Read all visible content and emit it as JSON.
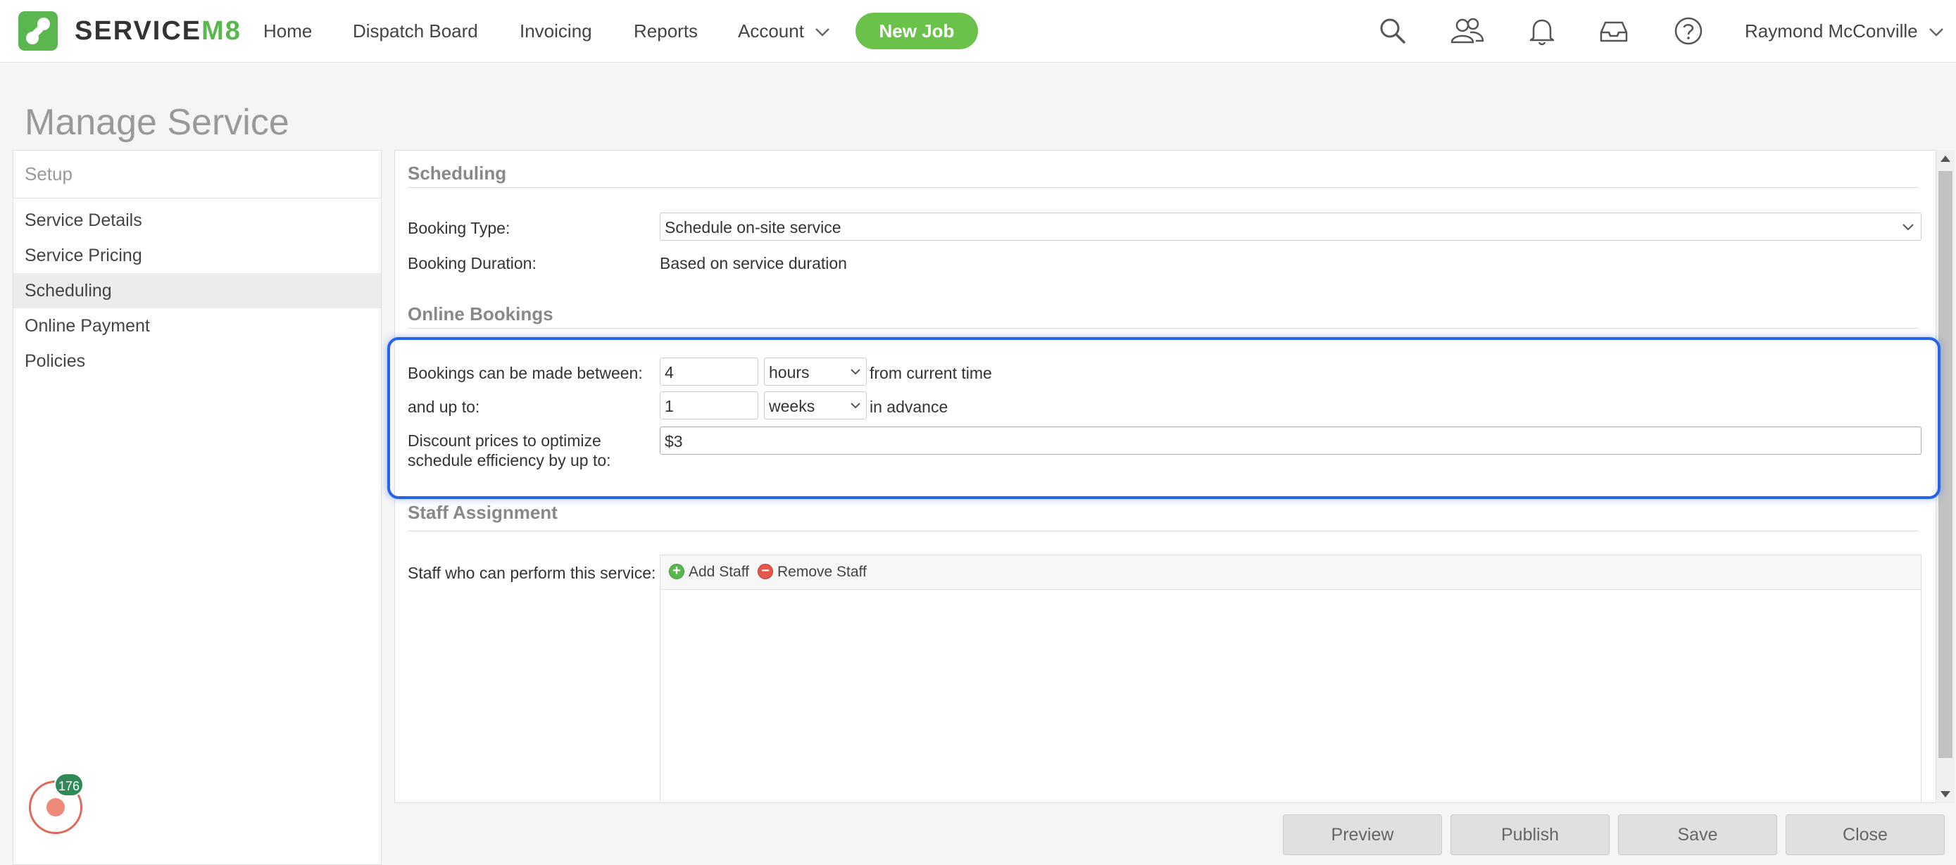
{
  "nav": {
    "logo_text": "SERVICE",
    "logo_suffix": "M8",
    "items": [
      "Home",
      "Dispatch Board",
      "Invoicing",
      "Reports",
      "Account"
    ],
    "new_job_label": "New Job",
    "icons": [
      "search-icon",
      "people-icon",
      "bell-icon",
      "inbox-icon",
      "help-icon"
    ],
    "user_name": "Raymond McConville"
  },
  "page": {
    "title": "Manage Service"
  },
  "sidebar": {
    "header": "Setup",
    "items": [
      {
        "label": "Service Details",
        "active": false
      },
      {
        "label": "Service Pricing",
        "active": false
      },
      {
        "label": "Scheduling",
        "active": true
      },
      {
        "label": "Online Payment",
        "active": false
      },
      {
        "label": "Policies",
        "active": false
      }
    ],
    "badge_count": "176"
  },
  "scheduling": {
    "title": "Scheduling",
    "booking_type_label": "Booking Type:",
    "booking_type_value": "Schedule on-site service",
    "booking_duration_label": "Booking Duration:",
    "booking_duration_value": "Based on service duration"
  },
  "online_bookings": {
    "title": "Online Bookings",
    "between_label": "Bookings can be made between:",
    "between_value": "4",
    "between_unit": "hours",
    "between_suffix": "from current time",
    "upto_label": "and up to:",
    "upto_value": "1",
    "upto_unit": "weeks",
    "upto_suffix": "in advance",
    "discount_label_line1": "Discount prices to optimize",
    "discount_label_line2": "schedule efficiency by up to:",
    "discount_value": "$3"
  },
  "staff_assignment": {
    "title": "Staff Assignment",
    "label": "Staff who can perform this service:",
    "add_label": "Add Staff",
    "remove_label": "Remove Staff"
  },
  "footer": {
    "preview": "Preview",
    "publish": "Publish",
    "save": "Save",
    "close": "Close"
  },
  "colors": {
    "brand_green": "#5ab74f",
    "new_job_green": "#6ac24b",
    "highlight_blue": "#2563eb",
    "badge_green": "#2e8b57",
    "record_red": "#e06a5a"
  }
}
